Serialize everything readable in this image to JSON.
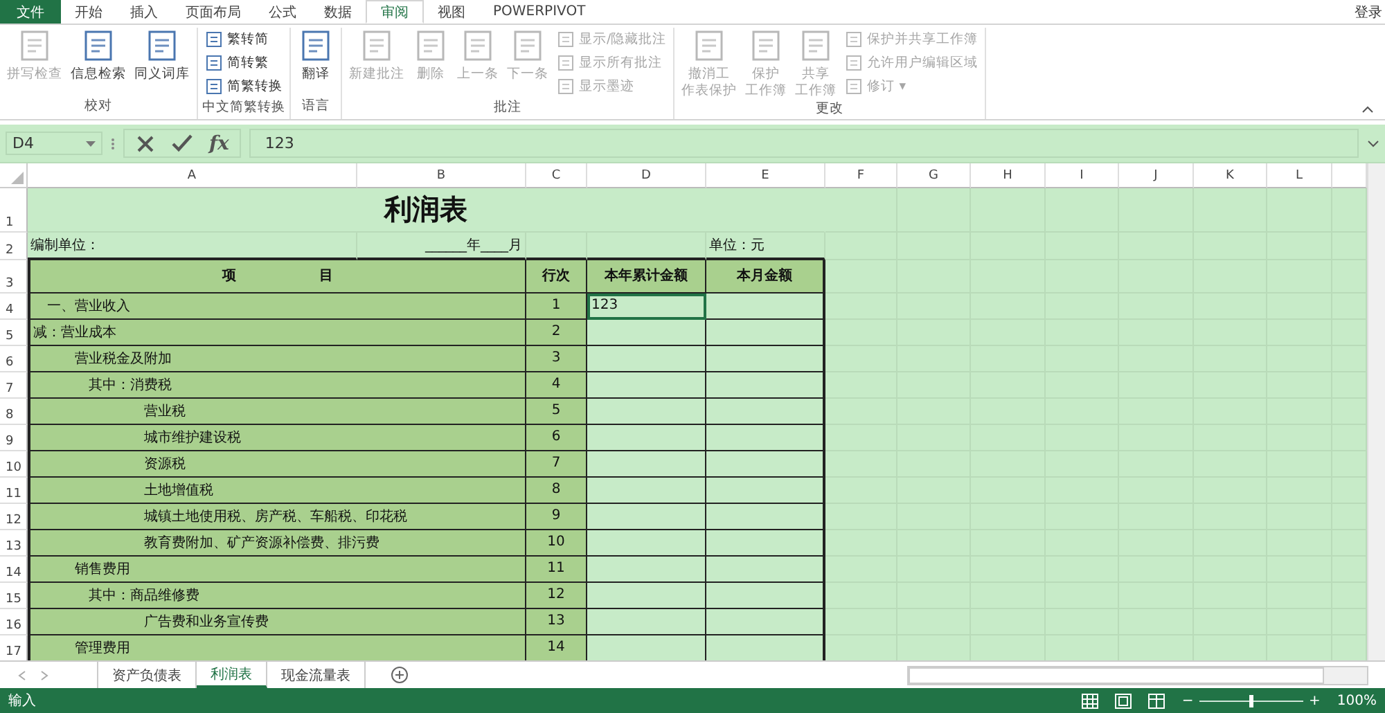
{
  "file_menu": "文件",
  "menu_tabs": [
    {
      "label": "开始",
      "selected": false
    },
    {
      "label": "插入",
      "selected": false
    },
    {
      "label": "页面布局",
      "selected": false
    },
    {
      "label": "公式",
      "selected": false
    },
    {
      "label": "数据",
      "selected": false
    },
    {
      "label": "审阅",
      "selected": true
    },
    {
      "label": "视图",
      "selected": false
    },
    {
      "label": "POWERPIVOT",
      "selected": false
    }
  ],
  "login": "登录",
  "ribbon_groups": [
    {
      "label": "校对",
      "commands": [
        {
          "kind": "large",
          "lines": [
            "拼写检查"
          ],
          "disabled": true
        },
        {
          "kind": "large",
          "lines": [
            "信息检索"
          ],
          "disabled": false
        },
        {
          "kind": "large",
          "lines": [
            "同义词库"
          ],
          "disabled": false
        }
      ]
    },
    {
      "label": "中文简繁转换",
      "commands": [
        {
          "kind": "small",
          "lines": [
            "繁转简"
          ],
          "disabled": false
        },
        {
          "kind": "small",
          "lines": [
            "简转繁"
          ],
          "disabled": false
        },
        {
          "kind": "small",
          "lines": [
            "简繁转换"
          ],
          "disabled": false
        }
      ]
    },
    {
      "label": "语言",
      "commands": [
        {
          "kind": "large",
          "lines": [
            "翻译"
          ],
          "disabled": false
        }
      ]
    },
    {
      "label": "批注",
      "commands": [
        {
          "kind": "large",
          "lines": [
            "新建批注"
          ],
          "disabled": true
        },
        {
          "kind": "large",
          "lines": [
            "删除"
          ],
          "disabled": true
        },
        {
          "kind": "large",
          "lines": [
            "上一条"
          ],
          "disabled": true
        },
        {
          "kind": "large",
          "lines": [
            "下一条"
          ],
          "disabled": true
        },
        {
          "kind": "small",
          "lines": [
            "显示/隐藏批注"
          ],
          "disabled": true
        },
        {
          "kind": "small",
          "lines": [
            "显示所有批注"
          ],
          "disabled": true
        },
        {
          "kind": "small",
          "lines": [
            "显示墨迹"
          ],
          "disabled": true
        }
      ]
    },
    {
      "label": "更改",
      "commands": [
        {
          "kind": "large",
          "lines": [
            "撤消工",
            "作表保护"
          ],
          "disabled": true
        },
        {
          "kind": "large",
          "lines": [
            "保护",
            "工作簿"
          ],
          "disabled": true
        },
        {
          "kind": "large",
          "lines": [
            "共享",
            "工作簿"
          ],
          "disabled": true
        },
        {
          "kind": "small",
          "lines": [
            "保护并共享工作簿"
          ],
          "disabled": true
        },
        {
          "kind": "small",
          "lines": [
            "允许用户编辑区域"
          ],
          "disabled": true
        },
        {
          "kind": "small",
          "lines": [
            "修订 ▾"
          ],
          "disabled": true
        }
      ]
    }
  ],
  "formula_bar": {
    "name_box": "D4",
    "function_button": "fx",
    "value": "123"
  },
  "columns": [
    "A",
    "B",
    "C",
    "D",
    "E",
    "F",
    "G",
    "H",
    "I",
    "J",
    "K",
    "L"
  ],
  "title_row": {
    "number": "1",
    "title": "利润表"
  },
  "info_row": {
    "number": "2",
    "unit_label": "编制单位：",
    "period": "______年____月",
    "currency": "单位：元"
  },
  "header_row": {
    "number": "3",
    "item": "项　　　　　　目",
    "line": "行次",
    "ytd": "本年累计金额",
    "month": "本月金额"
  },
  "rows": [
    {
      "number": "4",
      "item": "　一、营业收入",
      "line": "1",
      "ytd": "123",
      "selected": true
    },
    {
      "number": "5",
      "item": "减：营业成本",
      "line": "2",
      "selected": false
    },
    {
      "number": "6",
      "item": "　　　营业税金及附加",
      "line": "3",
      "selected": false
    },
    {
      "number": "7",
      "item": "　　　　其中：消费税",
      "line": "4",
      "selected": false
    },
    {
      "number": "8",
      "item": "　　　　　　　　营业税",
      "line": "5",
      "selected": false
    },
    {
      "number": "9",
      "item": "　　　　　　　　城市维护建设税",
      "line": "6",
      "selected": false
    },
    {
      "number": "10",
      "item": "　　　　　　　　资源税",
      "line": "7",
      "selected": false
    },
    {
      "number": "11",
      "item": "　　　　　　　　土地增值税",
      "line": "8",
      "selected": false
    },
    {
      "number": "12",
      "item": "　　　　　　　　城镇土地使用税、房产税、车船税、印花税",
      "line": "9",
      "selected": false
    },
    {
      "number": "13",
      "item": "　　　　　　　　教育费附加、矿产资源补偿费、排污费",
      "line": "10",
      "selected": false
    },
    {
      "number": "14",
      "item": "　　　销售费用",
      "line": "11",
      "selected": false
    },
    {
      "number": "15",
      "item": "　　　　其中：商品维修费",
      "line": "12",
      "selected": false
    },
    {
      "number": "16",
      "item": "　　　　　　　　广告费和业务宣传费",
      "line": "13",
      "selected": false
    },
    {
      "number": "17",
      "item": "　　　管理费用",
      "line": "14",
      "selected": false
    }
  ],
  "sheet_tabs": [
    {
      "label": "资产负债表",
      "selected": false
    },
    {
      "label": "利润表",
      "selected": true
    },
    {
      "label": "现金流量表",
      "selected": false
    }
  ],
  "status_bar": {
    "mode": "输入",
    "zoom_out": "−",
    "zoom_in": "+",
    "zoom": {
      "level": 0.5
    },
    "zoom_reading": "100%"
  }
}
